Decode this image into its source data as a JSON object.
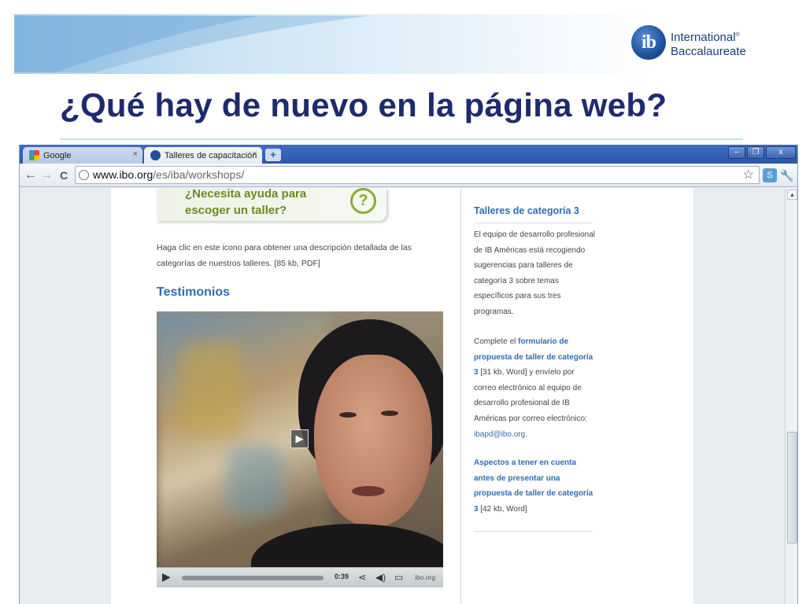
{
  "slide": {
    "title": "¿Qué hay de nuevo en la página web?",
    "logo_mark": "ib",
    "logo_line1": "International",
    "logo_line2": "Baccalaureate",
    "logo_reg": "®"
  },
  "browser": {
    "tabs": [
      {
        "label": "Google",
        "icon": "google-favicon"
      },
      {
        "label": "Talleres de capacitación",
        "icon": "ib-favicon"
      }
    ],
    "new_tab": "+",
    "window_controls": {
      "minimize": "–",
      "restore": "❐",
      "close": "x"
    },
    "url_host": "www.ibo.org",
    "url_path": "/es/iba/workshops/",
    "nav": {
      "back": "←",
      "forward": "→",
      "reload": "C"
    }
  },
  "page": {
    "help_banner_line1": "¿Necesita ayuda para",
    "help_banner_line2": "escoger un taller?",
    "help_icon": "?",
    "help_description": "Haga clic en este icono para obtener una descripción detallada de las categorías de nuestros talleres. [85 kb, PDF]",
    "testimonios_heading": "Testimonios",
    "video": {
      "time": "0:39",
      "brand": "ibo.org"
    },
    "sidebar": {
      "title": "Talleres de categoría 3",
      "para1": "El equipo de desarrollo profesional de IB Américas está recogiendo sugerencias para talleres de categoría 3 sobre temas específicos para sus tres programas.",
      "para2_prefix": "Complete el ",
      "para2_link": "formulario de propuesta de taller de categoría 3",
      "para2_suffix": " [31 kb, Word] y envíelo por correo electrónico al equipo de desarrollo profesional de IB Américas por correo electrónico: ",
      "para2_email": "ibapd@ibo.org",
      "para2_end": ".",
      "para3_link": "Aspectos a tener en cuenta antes de presentar una propuesta de taller de categoría 3",
      "para3_suffix": " [42 kb, Word]"
    }
  },
  "colors": {
    "title": "#1f2a6e",
    "link": "#2f6db1",
    "help_green": "#6c8a23"
  }
}
